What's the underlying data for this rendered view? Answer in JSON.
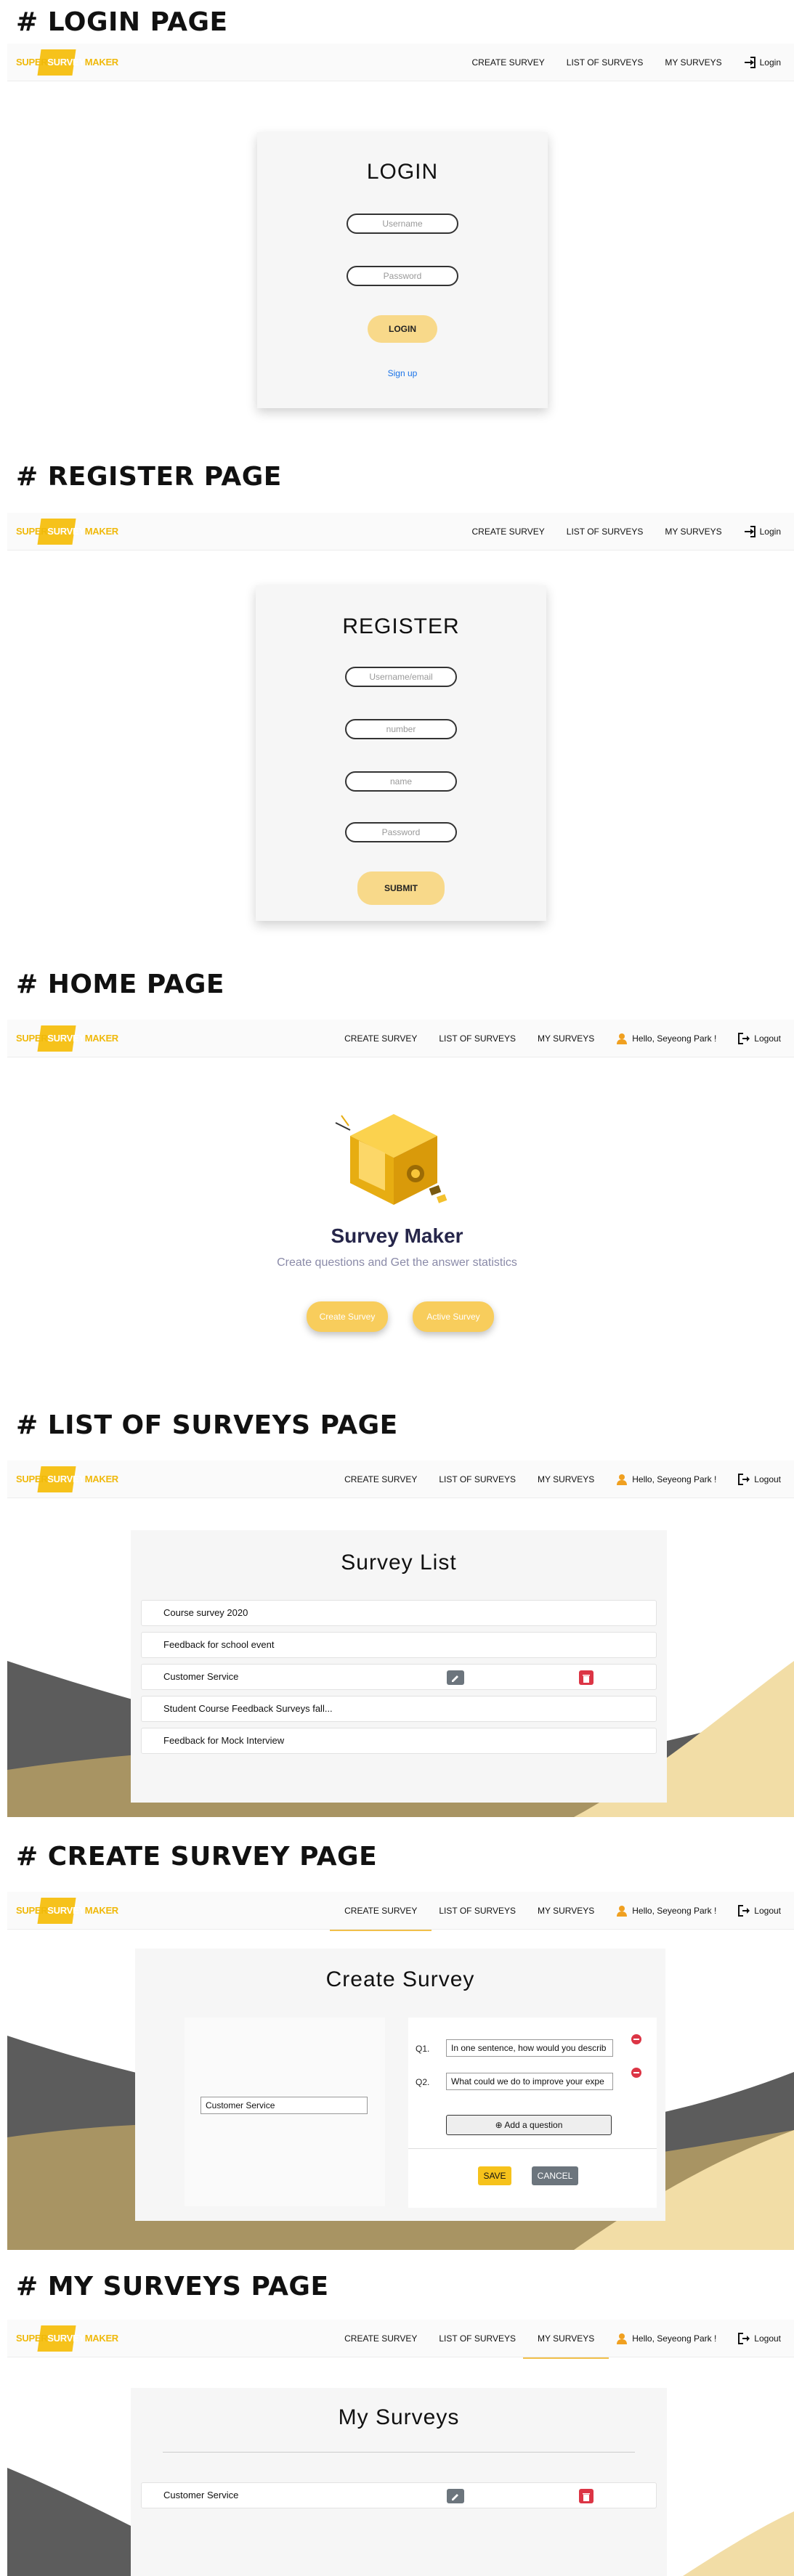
{
  "sections": {
    "login": "# LOGIN PAGE",
    "register": "# REGISTER PAGE",
    "home": "# HOME PAGE",
    "list": "# LIST OF SURVEYS PAGE",
    "create": "# CREATE SURVEY PAGE",
    "mine": "# MY SURVEYS PAGE"
  },
  "logo": {
    "left": "SUPER",
    "mid": "SURVEY",
    "right": "MAKER"
  },
  "nav": {
    "create": "CREATE SURVEY",
    "list": "LIST OF SURVEYS",
    "mine": "MY SURVEYS",
    "login": "Login",
    "hello": "Hello, Seyeong Park !",
    "logout": "Logout"
  },
  "login_page": {
    "title": "LOGIN",
    "username_placeholder": "Username",
    "password_placeholder": "Password",
    "button": "LOGIN",
    "signup": "Sign up"
  },
  "register_page": {
    "title": "REGISTER",
    "fields": [
      "Username/email",
      "number",
      "name",
      "Password"
    ],
    "button": "SUBMIT"
  },
  "home_page": {
    "title": "Survey Maker",
    "subtitle": "Create questions and Get the answer statistics",
    "create_button": "Create Survey",
    "active_button": "Active Survey"
  },
  "list_page": {
    "title": "Survey List",
    "surveys": [
      "Course survey 2020",
      "Feedback for school event",
      "Customer Service",
      "Student Course Feedback Surveys fall...",
      "Feedback for Mock Interview"
    ]
  },
  "create_page": {
    "title": "Create Survey",
    "survey_name": "Customer Service",
    "questions": [
      {
        "label": "Q1.",
        "text": "In one sentence, how would you describ"
      },
      {
        "label": "Q2.",
        "text": "What could we do to improve your expe"
      }
    ],
    "add_question": "Add a question",
    "save": "SAVE",
    "cancel": "CANCEL"
  },
  "mine_page": {
    "title": "My Surveys",
    "surveys": [
      "Customer Service"
    ]
  },
  "colors": {
    "accent": "#f6c21b",
    "button_soft": "#f8d98a",
    "wave_dark": "#5c5c5c",
    "wave_gold": "#a89463",
    "wave_light": "#f2dda6"
  }
}
